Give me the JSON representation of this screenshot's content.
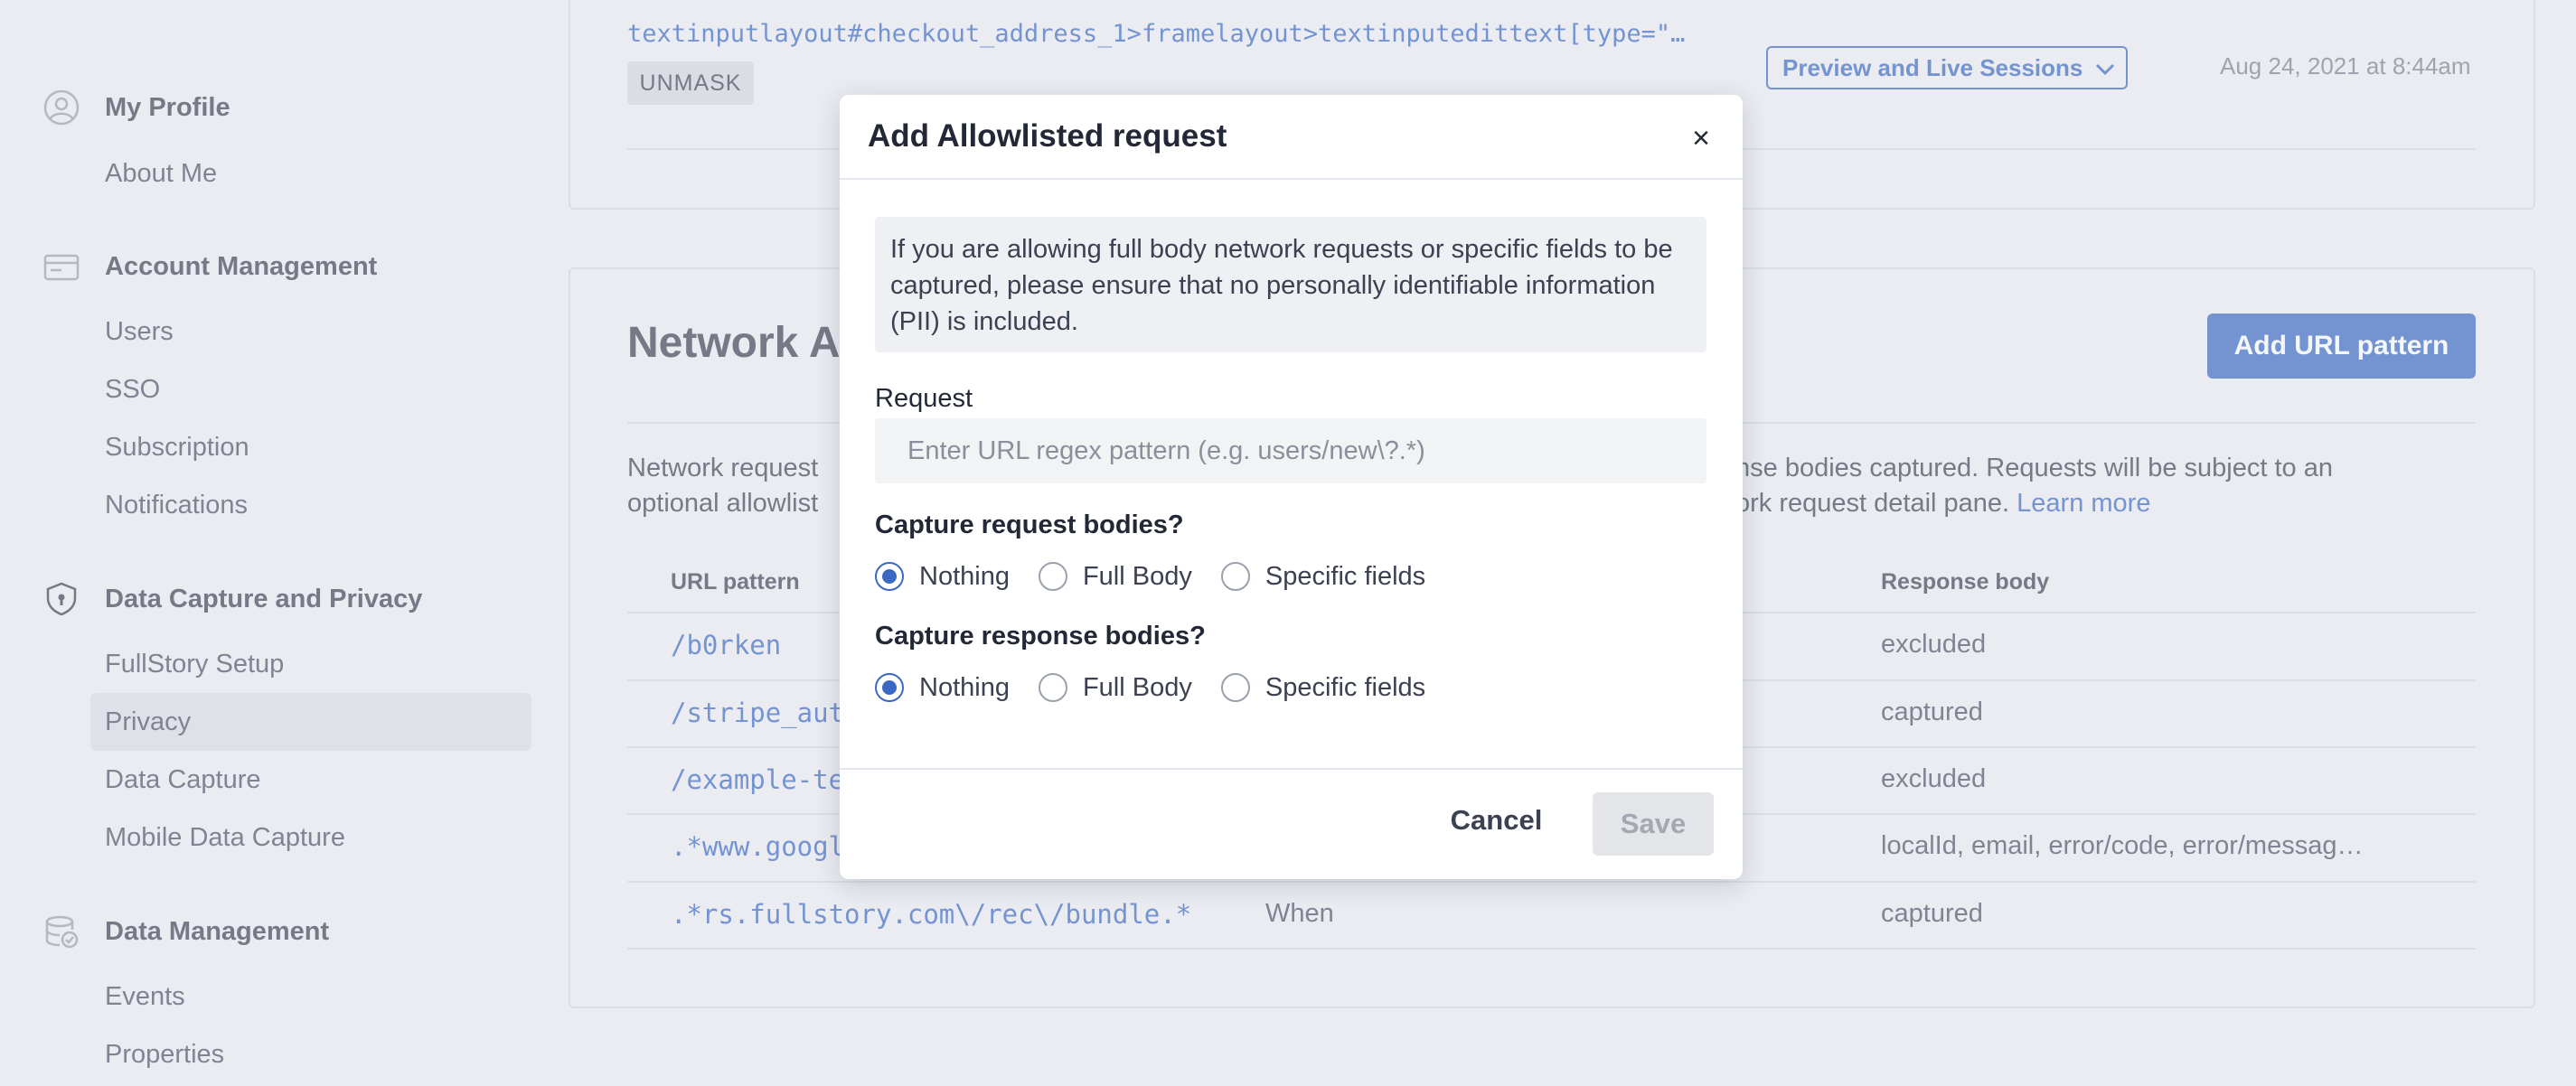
{
  "sidebar": {
    "sections": [
      {
        "title": "My Profile",
        "icon": "user-circle-icon",
        "items": [
          "About Me"
        ]
      },
      {
        "title": "Account Management",
        "icon": "credit-card-icon",
        "items": [
          "Users",
          "SSO",
          "Subscription",
          "Notifications"
        ]
      },
      {
        "title": "Data Capture and Privacy",
        "icon": "shield-lock-icon",
        "items": [
          "FullStory Setup",
          "Privacy",
          "Data Capture",
          "Mobile Data Capture"
        ]
      },
      {
        "title": "Data Management",
        "icon": "database-check-icon",
        "items": [
          "Events",
          "Properties"
        ]
      }
    ],
    "active_item": "Privacy"
  },
  "top_card": {
    "selector": "textinputlayout#checkout_address_1>framelayout>textinputedittext[type=\"…",
    "badge": "UNMASK",
    "session_dropdown": "Preview and Live Sessions",
    "date": "Aug 24, 2021 at 8:44am"
  },
  "network_card": {
    "title_visible": "Network A",
    "add_button": "Add URL pattern",
    "desc_line1_left": "Network request",
    "desc_line1_right": "nse bodies captured. Requests will be subject to an",
    "desc_line2_left": "optional allowlist",
    "desc_line2_right": "ork request detail pane.",
    "learn_more": "Learn more",
    "columns": {
      "url": "URL pattern",
      "response": "Response body"
    },
    "rows": [
      {
        "url": "/b0rken",
        "mid": "",
        "response": "excluded"
      },
      {
        "url": "/stripe_aut",
        "mid": "",
        "response": "captured"
      },
      {
        "url": "/example-te",
        "mid": "",
        "response": "excluded"
      },
      {
        "url": ".*www.googl",
        "mid": "",
        "response": "localId, email, error/code, error/messag…"
      },
      {
        "url": ".*rs.fullstory.com\\/rec\\/bundle.*",
        "mid": "When",
        "response": "captured"
      }
    ]
  },
  "modal": {
    "title": "Add Allowlisted request",
    "close": "×",
    "warning": "If you are allowing full body network requests or specific fields to be captured, please ensure that no personally identifiable information (PII) is included.",
    "request_label": "Request",
    "request_placeholder": "Enter URL regex pattern (e.g. users/new\\?.*)",
    "request_value": "",
    "req_bodies_label": "Capture request bodies?",
    "resp_bodies_label": "Capture response bodies?",
    "options": [
      "Nothing",
      "Full Body",
      "Specific fields"
    ],
    "req_selected": "Nothing",
    "resp_selected": "Nothing",
    "cancel": "Cancel",
    "save": "Save"
  },
  "colors": {
    "accent": "#3a69c4",
    "background": "#eef0f4",
    "text": "#3b4150"
  }
}
